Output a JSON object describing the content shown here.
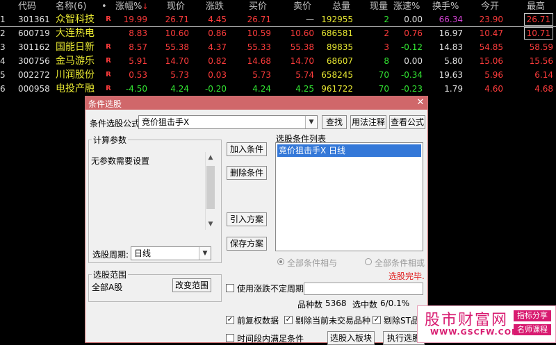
{
  "quote_table": {
    "header": {
      "code": "代码",
      "name": "名称(6)",
      "dot": "•",
      "chg_pct": "涨幅%",
      "sort_arrow": "↓",
      "price": "现价",
      "diff": "涨跌",
      "buy": "买价",
      "sell": "卖价",
      "volume": "总量",
      "cur_vol": "现量",
      "speed": "涨速%",
      "turnover": "换手%",
      "open": "今开",
      "high": "最高"
    },
    "rows": [
      {
        "idx": "1",
        "code": "301361",
        "name": "众智科技",
        "flag": "R",
        "chg": "19.99",
        "price": "26.71",
        "diff": "4.45",
        "buy": "26.71",
        "sell": "—",
        "volume": "192955",
        "cur": "2",
        "speed": "0.00",
        "turnover": "66.34",
        "open": "23.90",
        "high": "26.71"
      },
      {
        "idx": "2",
        "code": "600719",
        "name": "大连热电",
        "flag": "",
        "chg": "8.83",
        "price": "10.60",
        "diff": "0.86",
        "buy": "10.59",
        "sell": "10.60",
        "volume": "686581",
        "cur": "2",
        "speed": "0.76",
        "turnover": "16.97",
        "open": "10.47",
        "high": "10.71"
      },
      {
        "idx": "3",
        "code": "301162",
        "name": "国能日新",
        "flag": "R",
        "chg": "8.57",
        "price": "55.38",
        "diff": "4.37",
        "buy": "55.33",
        "sell": "55.38",
        "volume": "89835",
        "cur": "3",
        "speed": "-0.12",
        "turnover": "14.83",
        "open": "54.85",
        "high": "58.59"
      },
      {
        "idx": "4",
        "code": "300756",
        "name": "金马游乐",
        "flag": "R",
        "chg": "5.91",
        "price": "14.70",
        "diff": "0.82",
        "buy": "14.68",
        "sell": "14.70",
        "volume": "68607",
        "cur": "8",
        "speed": "0.00",
        "turnover": "5.80",
        "open": "15.06",
        "high": "15.56"
      },
      {
        "idx": "5",
        "code": "002272",
        "name": "川润股份",
        "flag": "R",
        "chg": "0.53",
        "price": "5.73",
        "diff": "0.03",
        "buy": "5.73",
        "sell": "5.74",
        "volume": "658245",
        "cur": "70",
        "speed": "-0.34",
        "turnover": "19.63",
        "open": "5.96",
        "high": "6.14"
      },
      {
        "idx": "6",
        "code": "000958",
        "name": "电投产融",
        "flag": "R",
        "chg": "-4.50",
        "price": "4.24",
        "diff": "-0.20",
        "buy": "4.24",
        "sell": "4.25",
        "volume": "961722",
        "cur": "70",
        "speed": "-0.23",
        "turnover": "1.79",
        "open": "4.60",
        "high": "4.68"
      }
    ]
  },
  "dialog": {
    "title": "条件选股",
    "close_glyph": "✕",
    "formula_label": "条件选股公式",
    "formula_value": "竞价狙击手X",
    "btn_find": "查找",
    "btn_usage": "用法注释",
    "btn_view_formula": "查看公式",
    "params_group": "计算参数",
    "params_text": "无参数需要设置",
    "btn_add": "加入条件",
    "btn_delete": "删除条件",
    "btn_import": "引入方案",
    "btn_save": "保存方案",
    "cond_list_label": "选股条件列表",
    "cond_list_items": [
      "竞价狙击手X  日线"
    ],
    "period_label": "选股周期:",
    "period_value": "日线",
    "radio_and": "全部条件相与",
    "radio_or": "全部条件相或",
    "status_done": "选股完毕.",
    "range_group": "选股范围",
    "range_value": "全部A股",
    "btn_change_range": "改变范围",
    "chk_indefinite": "使用涨跌不定周期",
    "count_label": "品种数",
    "count_value": "5368",
    "hit_label": "选中数",
    "hit_value": "6/0.1%",
    "chk_pre_adjust": "前复权数据",
    "chk_exclude_untraded": "剔除当前未交易品种",
    "chk_exclude_st": "剔除ST品",
    "chk_period_satisfy": "时间段内满足条件",
    "btn_to_board": "选股入板块",
    "btn_execute": "执行选股"
  },
  "watermark": {
    "main": "股市财富网",
    "url": "WWW.GSCFW.COM",
    "tag1": "指标分享",
    "tag2": "名师课程"
  },
  "colors": {
    "up": "#ff3c3c",
    "down": "#32e632",
    "volume": "#e8e832",
    "dialog_title": "#d0676a",
    "selection": "#3478d8",
    "watermark": "#d81b70"
  }
}
